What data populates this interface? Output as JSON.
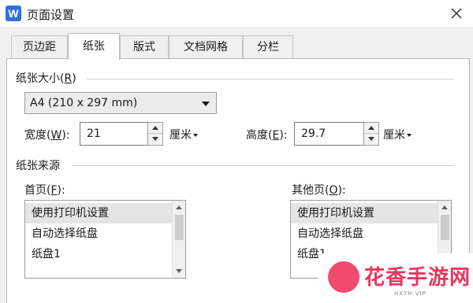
{
  "window": {
    "app_icon_letter": "W",
    "title": "页面设置",
    "close_glyph": "✕"
  },
  "tabs": [
    {
      "label": "页边距",
      "active": false
    },
    {
      "label": "纸张",
      "active": true
    },
    {
      "label": "版式",
      "active": false
    },
    {
      "label": "文档网格",
      "active": false
    },
    {
      "label": "分栏",
      "active": false
    }
  ],
  "paper_size": {
    "group_label_prefix": "纸张大小(",
    "group_label_key": "R",
    "group_label_suffix": ")",
    "selected": "A4 (210 x 297 mm)",
    "width": {
      "label_prefix": "宽度(",
      "key": "W",
      "label_suffix": "):",
      "value": "21",
      "unit": "厘米"
    },
    "height": {
      "label_prefix": "高度(",
      "key": "E",
      "label_suffix": "):",
      "value": "29.7",
      "unit": "厘米"
    }
  },
  "paper_source": {
    "group_label": "纸张来源",
    "first_page": {
      "label_prefix": "首页(",
      "key": "F",
      "label_suffix": "):",
      "items": [
        "使用打印机设置",
        "自动选择纸盘",
        "纸盘1"
      ],
      "selected_index": 0
    },
    "other_pages": {
      "label_prefix": "其他页(",
      "key": "O",
      "label_suffix": "):",
      "items": [
        "使用打印机设置",
        "自动选择纸盘",
        "纸盘1"
      ],
      "selected_index": 0
    }
  },
  "logo_text": {
    "name": "花香手游网",
    "url": "HXYH.VIP"
  },
  "colors": {
    "accent": "#2f6fde",
    "brand": "#e8365e"
  }
}
